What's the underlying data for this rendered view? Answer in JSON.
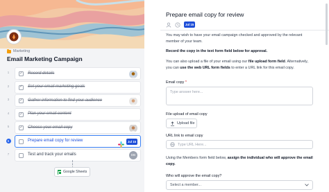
{
  "workflow": {
    "breadcrumb": "Marketing",
    "title": "Email Marketing Campaign",
    "steps": [
      {
        "num": "1",
        "label": "Record details",
        "done": true
      },
      {
        "num": "2",
        "label": "Set your email marketing goals",
        "done": true
      },
      {
        "num": "3",
        "label": "Gather information to find your audience",
        "done": true
      },
      {
        "num": "4",
        "label": "Plan your email content",
        "done": true
      },
      {
        "num": "5",
        "label": "Choose your email copy",
        "done": true
      },
      {
        "num": "6",
        "label": "Prepare email copy for review",
        "done": false,
        "due": "Jul 15"
      },
      {
        "num": "7",
        "label": "Test and track your emails",
        "done": false,
        "assignee": "DB"
      }
    ],
    "integration": "Google Sheets"
  },
  "task": {
    "title": "Prepare email copy for review",
    "due": "Jul 15",
    "intro": "You may wish to have your email campaign checked and approved by the relevant member of your team.",
    "instruction1": "Record the copy in the text form field below for approval.",
    "upload_text_a": "You can also upload a file of your email using our ",
    "upload_text_b": "file upload form field",
    "upload_text_c": ". Alternatively, you can ",
    "upload_text_d": "use the web URL form fields",
    "upload_text_e": " to enter a URL link for this email copy.",
    "email_copy_label": "Email copy",
    "email_copy_required": "*",
    "email_copy_placeholder": "Type answer here...",
    "file_upload_label": "File upload of email copy",
    "upload_button": "Upload file",
    "url_label": "URL link to email copy",
    "url_placeholder": "Type URL Here...",
    "members_text_a": "Using the Members form field below, ",
    "members_text_b": "assign the individual who will approve the email copy.",
    "approver_label": "Who will approve the email copy?",
    "approver_placeholder": "Select a member..."
  },
  "colors": {
    "accent": "#2563eb",
    "due_badge": "#1d4ed8"
  }
}
